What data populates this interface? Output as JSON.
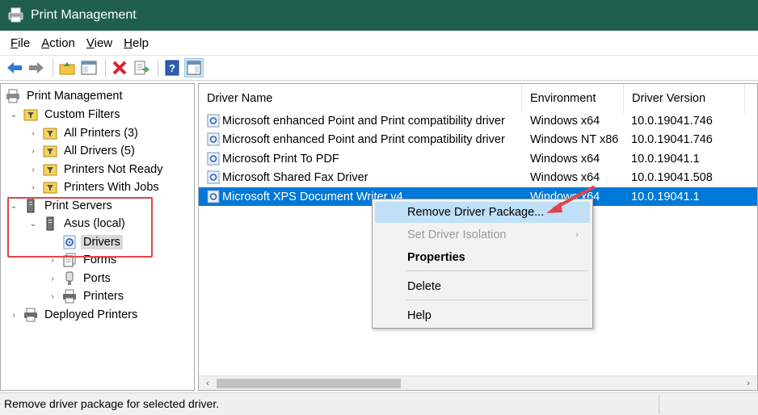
{
  "window": {
    "title": "Print Management"
  },
  "menu": [
    {
      "label": "File",
      "access": "F"
    },
    {
      "label": "Action",
      "access": "A"
    },
    {
      "label": "View",
      "access": "V"
    },
    {
      "label": "Help",
      "access": "H"
    }
  ],
  "toolbar": {
    "buttons": [
      "back-arrow-icon",
      "forward-arrow-icon",
      "up-folder-icon",
      "show-hide-tree-icon",
      "delete-icon",
      "export-list-icon",
      "help-icon",
      "show-action-pane-icon"
    ]
  },
  "tree": {
    "root": "Print Management",
    "custom_filters": "Custom Filters",
    "all_printers": "All Printers (3)",
    "all_drivers": "All Drivers (5)",
    "printers_not_ready": "Printers Not Ready",
    "printers_with_jobs": "Printers With Jobs",
    "print_servers": "Print Servers",
    "asus_local": "Asus (local)",
    "drivers": "Drivers",
    "forms": "Forms",
    "ports": "Ports",
    "printers": "Printers",
    "deployed_printers": "Deployed Printers"
  },
  "list": {
    "columns": [
      "Driver Name",
      "Environment",
      "Driver Version"
    ],
    "rows": [
      {
        "name": "Microsoft enhanced Point and Print compatibility driver",
        "env": "Windows x64",
        "version": "10.0.19041.746"
      },
      {
        "name": "Microsoft enhanced Point and Print compatibility driver",
        "env": "Windows NT x86",
        "version": "10.0.19041.746"
      },
      {
        "name": "Microsoft Print To PDF",
        "env": "Windows x64",
        "version": "10.0.19041.1"
      },
      {
        "name": "Microsoft Shared Fax Driver",
        "env": "Windows x64",
        "version": "10.0.19041.508"
      },
      {
        "name": "Microsoft XPS Document Writer v4",
        "env": "Windows x64",
        "version": "10.0.19041.1"
      }
    ],
    "selected_index": 4
  },
  "context_menu": {
    "remove": "Remove Driver Package...",
    "set_isolation": "Set Driver Isolation",
    "properties": "Properties",
    "delete": "Delete",
    "help": "Help"
  },
  "status": {
    "text": "Remove driver package for selected driver."
  },
  "colors": {
    "titlebar": "#1f5f4b",
    "selection": "#0078d7",
    "highlight_box": "#e0464b",
    "menu_hover": "#bfe0f7"
  }
}
